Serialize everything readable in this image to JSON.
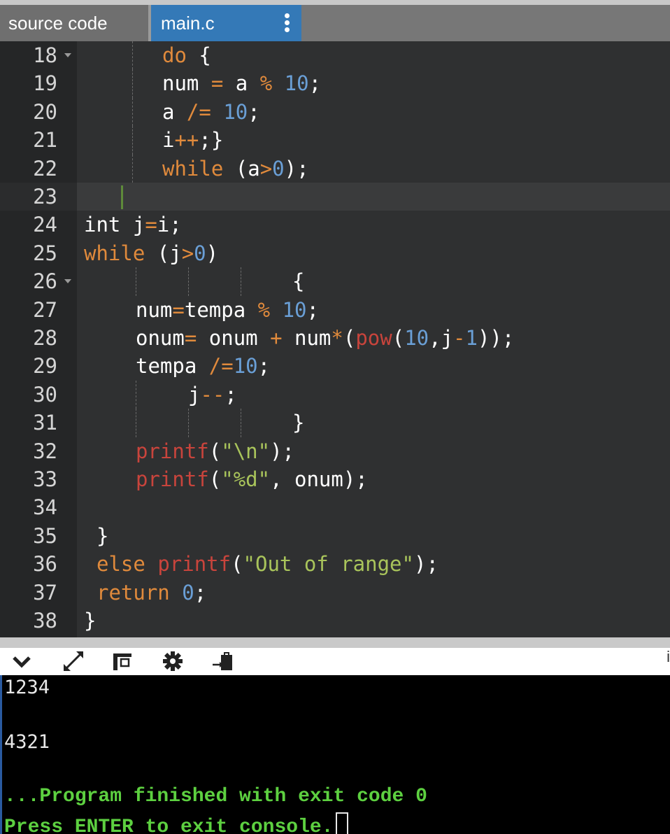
{
  "tabs": {
    "source_label": "source code",
    "main_label": "main.c"
  },
  "editor": {
    "lines": [
      {
        "n": "18",
        "fold": true
      },
      {
        "n": "19",
        "fold": false
      },
      {
        "n": "20",
        "fold": false
      },
      {
        "n": "21",
        "fold": false
      },
      {
        "n": "22",
        "fold": false
      },
      {
        "n": "23",
        "fold": false,
        "active": true
      },
      {
        "n": "24",
        "fold": false
      },
      {
        "n": "25",
        "fold": false
      },
      {
        "n": "26",
        "fold": true
      },
      {
        "n": "27",
        "fold": false
      },
      {
        "n": "28",
        "fold": false
      },
      {
        "n": "29",
        "fold": false
      },
      {
        "n": "30",
        "fold": false
      },
      {
        "n": "31",
        "fold": false
      },
      {
        "n": "32",
        "fold": false
      },
      {
        "n": "33",
        "fold": false
      },
      {
        "n": "34",
        "fold": false
      },
      {
        "n": "35",
        "fold": false
      },
      {
        "n": "36",
        "fold": false
      },
      {
        "n": "37",
        "fold": false
      },
      {
        "n": "38",
        "fold": false
      }
    ],
    "code": {
      "l18": [
        "do",
        " {"
      ],
      "l19": [
        "num ",
        "=",
        " a ",
        "%",
        " ",
        "10",
        ";"
      ],
      "l20": [
        "a ",
        "/=",
        " ",
        "10",
        ";"
      ],
      "l21": [
        "i",
        "++",
        ";}"
      ],
      "l22": [
        "while",
        " (a",
        ">",
        "0",
        ");"
      ],
      "l24": [
        "int",
        " j",
        "=",
        "i;"
      ],
      "l25": [
        "while",
        " (j",
        ">",
        "0",
        ")"
      ],
      "l26": [
        "{"
      ],
      "l27": [
        "num",
        "=",
        "tempa ",
        "%",
        " ",
        "10",
        ";"
      ],
      "l28": [
        "onum",
        "=",
        " onum ",
        "+",
        " num",
        "*",
        "(",
        "pow",
        "(",
        "10",
        ",j",
        "-",
        "1",
        "));"
      ],
      "l29": [
        "tempa ",
        "/=",
        "10",
        ";"
      ],
      "l30": [
        "j",
        "--",
        ";"
      ],
      "l31": [
        "}"
      ],
      "l32": [
        "printf",
        "(",
        "\"\\n\"",
        ");"
      ],
      "l33": [
        "printf",
        "(",
        "\"%d\"",
        ", onum);"
      ],
      "l35": [
        "}"
      ],
      "l36": [
        "else",
        " ",
        "printf",
        "(",
        "\"Out of range\"",
        ");"
      ],
      "l37": [
        "return",
        " ",
        "0",
        ";"
      ],
      "l38": [
        "}"
      ]
    }
  },
  "toolbar": {
    "icons": [
      "chevron-down-icon",
      "expand-icon",
      "layout-icon",
      "gear-icon",
      "clipboard-icon"
    ],
    "trailing_letter": "i"
  },
  "console": {
    "output1": "1234",
    "output2": "4321",
    "finished": "...Program finished with exit code 0",
    "press_enter": "Press ENTER to exit console."
  },
  "colors": {
    "keyword": "#e08a3c",
    "number": "#6a9fd6",
    "function": "#c8443c",
    "string": "#a9c45b",
    "console_green": "#5dd040",
    "active_tab": "#3479b7"
  }
}
